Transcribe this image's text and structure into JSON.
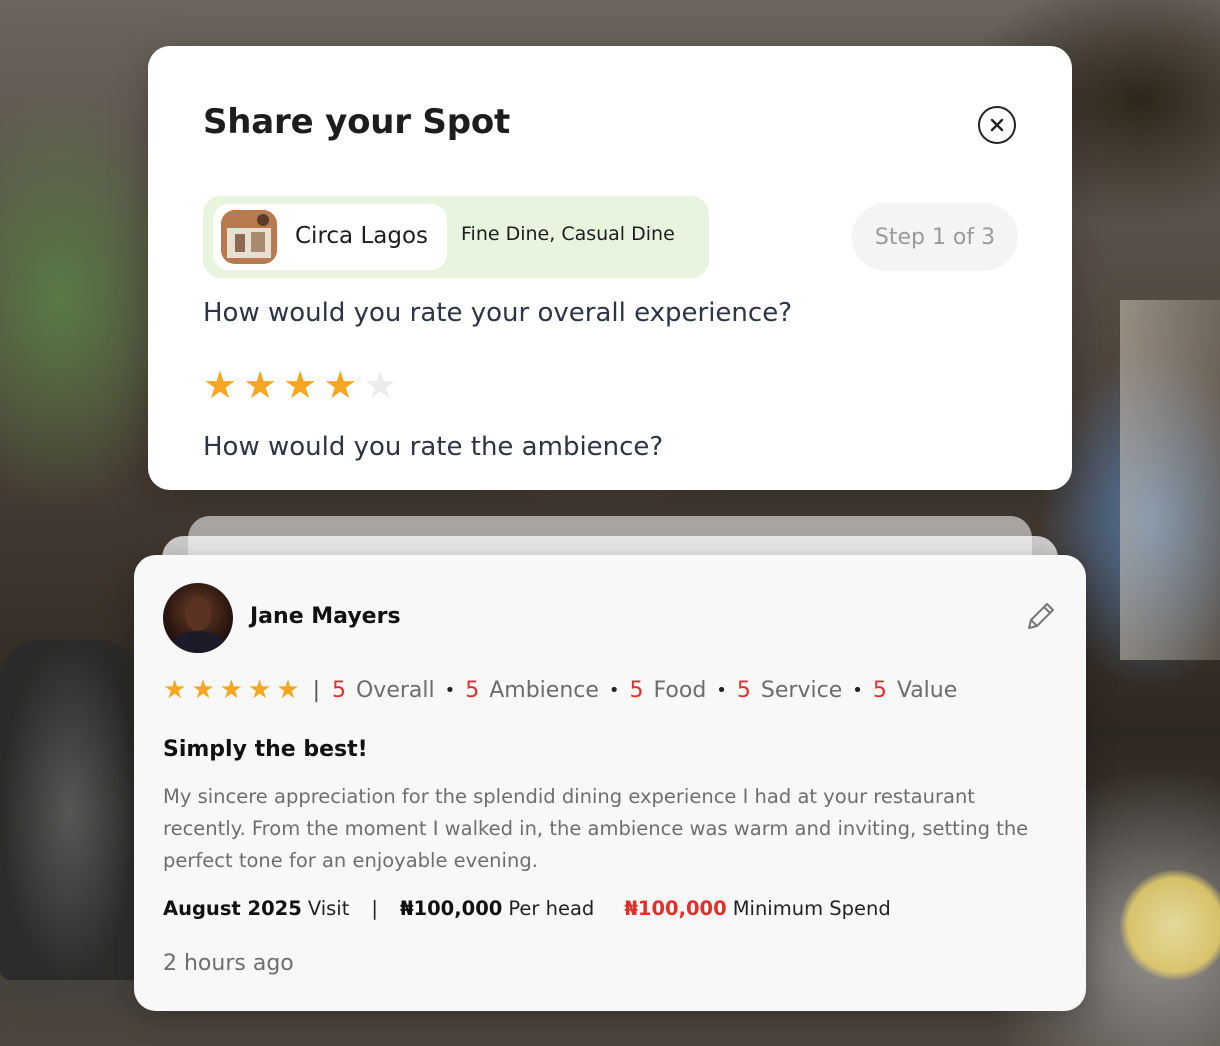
{
  "modal": {
    "title": "Share your Spot",
    "close_icon": "close-circle-icon",
    "venue": {
      "name": "Circa Lagos",
      "categories": "Fine Dine, Casual Dine"
    },
    "step": "Step 1 of 3",
    "question_overall": "How would you rate your overall experience?",
    "overall_rating": 4,
    "rating_max": 5,
    "question_ambience": "How would you rate the ambience?"
  },
  "review": {
    "reviewer_name": "Jane Mayers",
    "edit_icon": "pencil-icon",
    "star_rating": 5,
    "scores": [
      {
        "value": "5",
        "label": "Overall"
      },
      {
        "value": "5",
        "label": "Ambience"
      },
      {
        "value": "5",
        "label": "Food"
      },
      {
        "value": "5",
        "label": "Service"
      },
      {
        "value": "5",
        "label": "Value"
      }
    ],
    "title": "Simply the best!",
    "body": "My sincere appreciation for the splendid dining experience I had at your restaurant recently. From the moment I walked in, the ambience was warm and inviting, setting the perfect tone for an enjoyable evening.",
    "visit_date": "August 2025",
    "visit_suffix": "Visit",
    "per_head_amount": "₦100,000",
    "per_head_label": "Per head",
    "min_spend_amount": "₦100,000",
    "min_spend_label": "Minimum Spend",
    "time_ago": "2 hours ago"
  },
  "colors": {
    "star": "#f5a623",
    "star_empty": "#ececec",
    "accent_red": "#e0302b",
    "venue_pill_bg": "#e9f4df"
  }
}
